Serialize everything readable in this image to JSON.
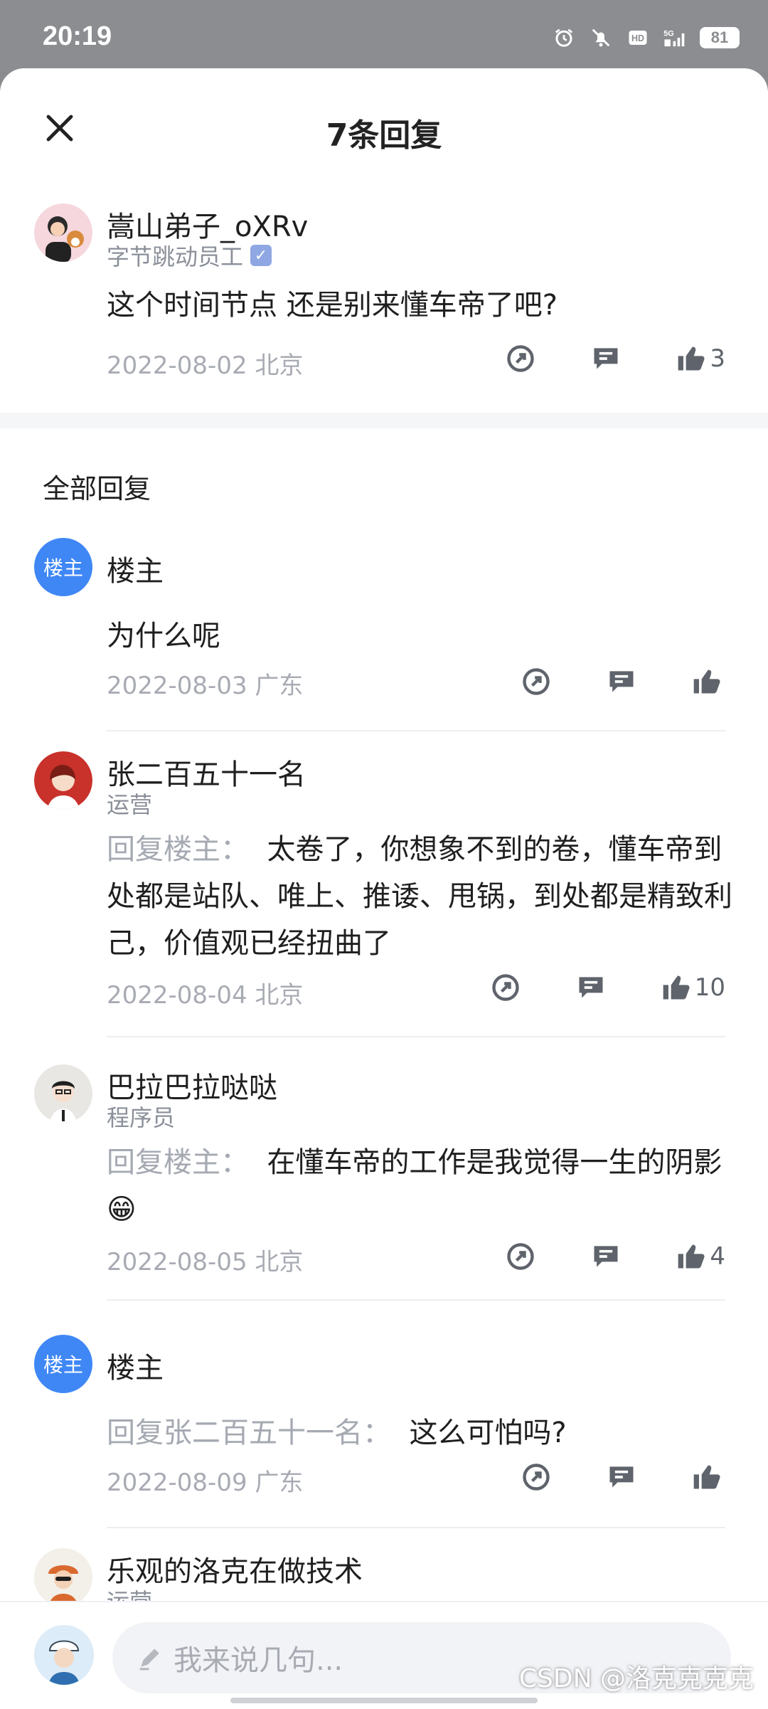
{
  "status_bar": {
    "time": "20:19",
    "battery": "81"
  },
  "header": {
    "title": "7条回复"
  },
  "main_comment": {
    "username": "嵩山弟子_oXRv",
    "role": "字节跳动员工",
    "text": "这个时间节点 还是别来懂车帝了吧?",
    "meta": "2022-08-02  北京",
    "likes": "3"
  },
  "section_title": "全部回复",
  "replies": [
    {
      "username": "楼主",
      "badge": "楼主",
      "role": "",
      "reply_prefix": "",
      "text": "为什么呢",
      "meta": "2022-08-03  广东",
      "likes": ""
    },
    {
      "username": "张二百五十一名",
      "role": "运营",
      "reply_prefix": "回复楼主：",
      "text": "太卷了，你想象不到的卷，懂车帝到处都是站队、唯上、推诿、甩锅，到处都是精致利己，价值观已经扭曲了",
      "meta": "2022-08-04  北京",
      "likes": "10"
    },
    {
      "username": "巴拉巴拉哒哒",
      "role": "程序员",
      "reply_prefix": "回复楼主：",
      "text": "在懂车帝的工作是我觉得一生的阴影",
      "emoji": "😁",
      "meta": "2022-08-05  北京",
      "likes": "4"
    },
    {
      "username": "楼主",
      "badge": "楼主",
      "role": "",
      "reply_prefix": "回复张二百五十一名：",
      "text": "这么可怕吗?",
      "meta": "2022-08-09  广东",
      "likes": ""
    },
    {
      "username": "乐观的洛克在做技术",
      "role": "运营"
    }
  ],
  "input": {
    "placeholder": "我来说几句..."
  },
  "watermark": "@洛克克克克",
  "watermark_logo": "CSDN"
}
